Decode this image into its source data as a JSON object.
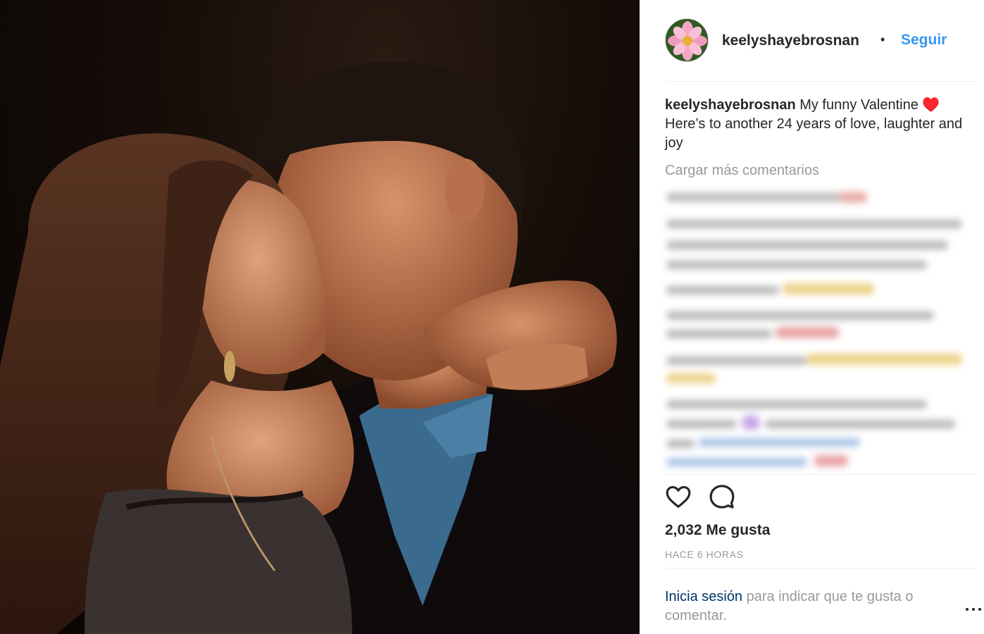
{
  "post": {
    "username": "keelyshayebrosnan",
    "dot": "•",
    "follow_label": "Seguir",
    "caption_text": "My funny Valentine ♥️ Here’s to another 24 years of love, laughter and joy",
    "load_more": "Cargar más comentarios",
    "likes": "2,032 Me gusta",
    "time": "HACE 6 HORAS",
    "login_link": "Inicia sesión",
    "login_rest": " para indicar que te gusta o comentar."
  },
  "icons": {
    "like": "heart-icon",
    "comment": "comment-icon",
    "more": "ellipsis-icon",
    "avatar": "flower-avatar"
  },
  "colors": {
    "link_blue": "#3897f0",
    "login_link": "#003569",
    "muted": "#999999",
    "text": "#262626"
  }
}
